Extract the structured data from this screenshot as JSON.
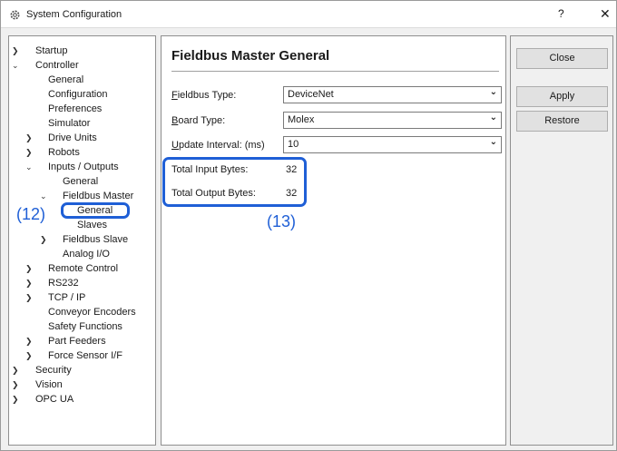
{
  "window": {
    "title": "System Configuration",
    "help_glyph": "?",
    "close_glyph": "✕"
  },
  "tree": {
    "startup": "Startup",
    "controller": "Controller",
    "general": "General",
    "configuration": "Configuration",
    "preferences": "Preferences",
    "simulator": "Simulator",
    "drive_units": "Drive Units",
    "robots": "Robots",
    "inputs_outputs": "Inputs / Outputs",
    "io_general": "General",
    "fieldbus_master": "Fieldbus Master",
    "fm_general": "General",
    "slaves": "Slaves",
    "fieldbus_slave": "Fieldbus Slave",
    "analog_io": "Analog I/O",
    "remote_control": "Remote Control",
    "rs232": "RS232",
    "tcp_ip": "TCP / IP",
    "conveyor_encoders": "Conveyor Encoders",
    "safety_functions": "Safety Functions",
    "part_feeders": "Part Feeders",
    "force_sensor": "Force Sensor I/F",
    "security": "Security",
    "vision": "Vision",
    "opc_ua": "OPC UA"
  },
  "content": {
    "title": "Fieldbus Master General",
    "fieldbus_type": {
      "label_key": "F",
      "label_rest": "ieldbus Type:",
      "value": "DeviceNet"
    },
    "board_type": {
      "label_key": "B",
      "label_rest": "oard Type:",
      "value": "Molex"
    },
    "update_interval": {
      "label_key": "U",
      "label_rest": "pdate Interval: (ms)",
      "value": "10"
    },
    "total_input": {
      "label": "Total Input Bytes:",
      "value": "32"
    },
    "total_output": {
      "label": "Total Output Bytes:",
      "value": "32"
    }
  },
  "buttons": {
    "close": "Close",
    "apply": "Apply",
    "restore": "Restore"
  },
  "callouts": {
    "c12": "(12)",
    "c13": "(13)"
  },
  "colors": {
    "callout": "#1f5fd6"
  },
  "icons": {
    "expanded": "chevron-down-icon",
    "collapsed": "chevron-right-icon",
    "title": "gear-icon"
  }
}
